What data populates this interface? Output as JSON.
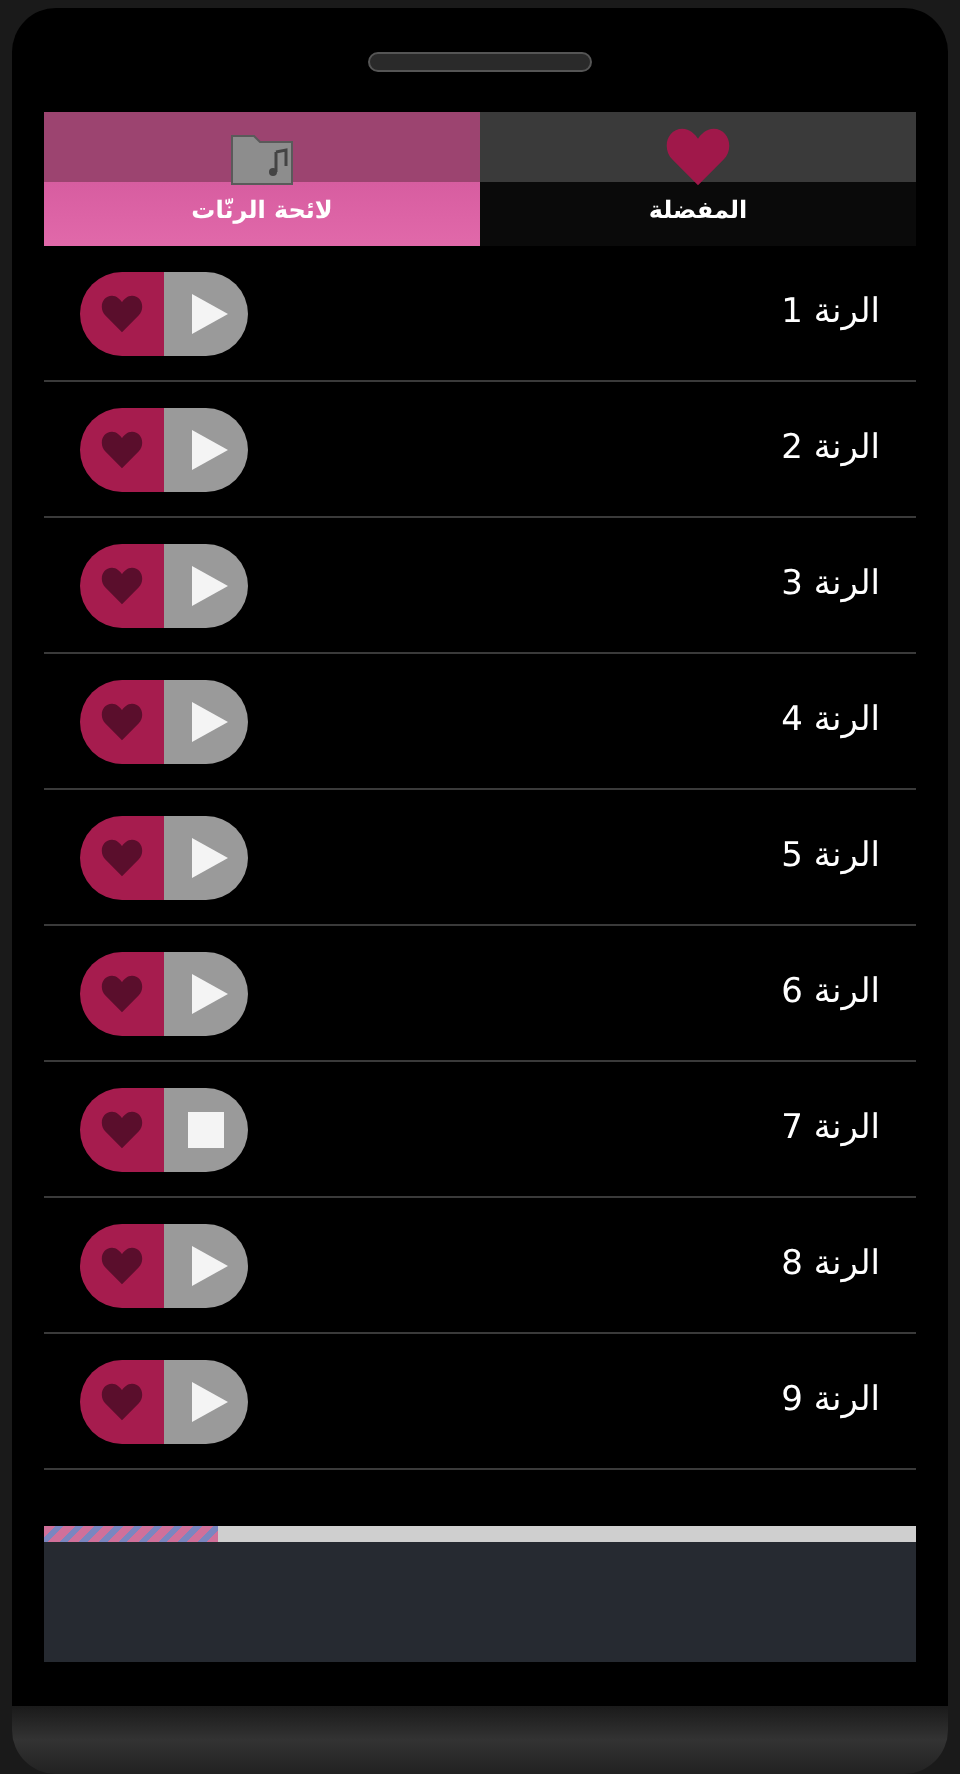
{
  "tabs": [
    {
      "label": "المفضلة",
      "selected": false,
      "kind": "heart"
    },
    {
      "label": "لائحة الرنّات",
      "selected": true,
      "kind": "folder"
    }
  ],
  "ringtones": [
    {
      "title": "الرنة 1",
      "playing": false
    },
    {
      "title": "الرنة 2",
      "playing": false
    },
    {
      "title": "الرنة 3",
      "playing": false
    },
    {
      "title": "الرنة 4",
      "playing": false
    },
    {
      "title": "الرنة 5",
      "playing": false
    },
    {
      "title": "الرنة 6",
      "playing": false
    },
    {
      "title": "الرنة 7",
      "playing": true
    },
    {
      "title": "الرنة 8",
      "playing": false
    },
    {
      "title": "الرنة 9",
      "playing": false
    }
  ],
  "progress": {
    "level": 0.2
  }
}
